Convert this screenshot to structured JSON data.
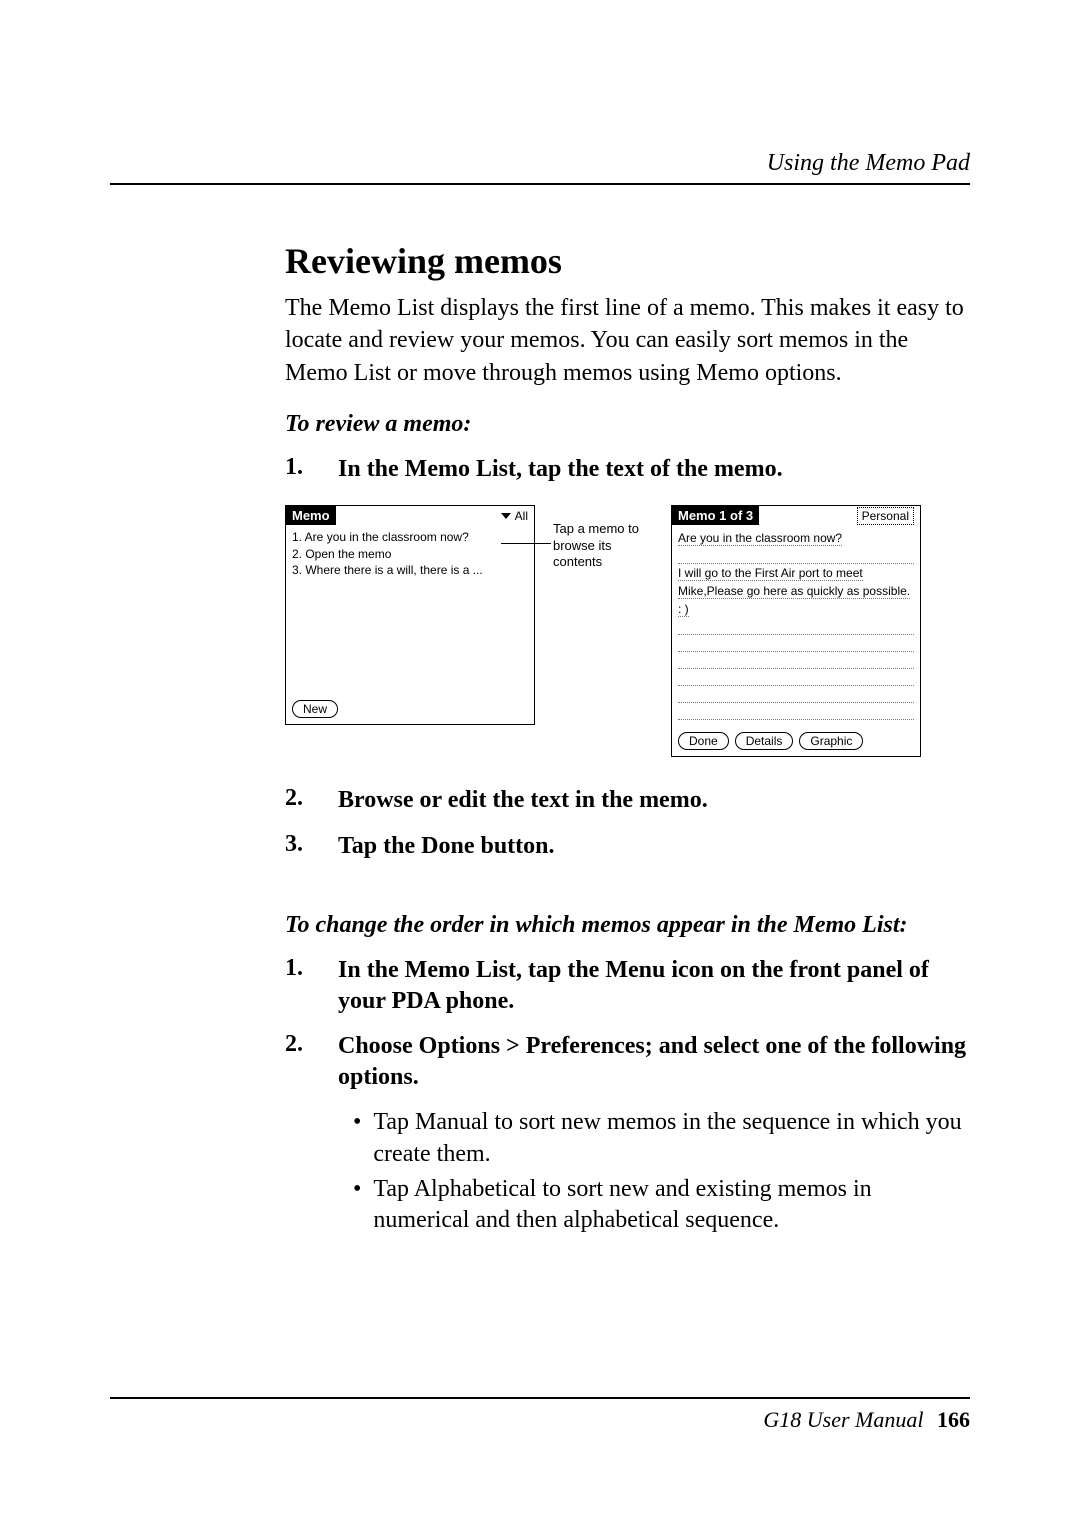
{
  "header": {
    "section": "Using the Memo Pad"
  },
  "h1": "Reviewing memos",
  "intro": "The Memo List displays the first line of a memo. This makes it easy to locate and review your memos. You can easily sort memos in the Memo List or move through memos using Memo options.",
  "review": {
    "subhead": "To review a memo:",
    "steps": [
      "In the Memo List, tap the text of the memo.",
      "Browse or edit the text in the memo.",
      "Tap the Done button."
    ]
  },
  "change_order": {
    "subhead": "To change the order in which memos appear in the Memo List:",
    "steps": [
      "In the Memo List, tap the Menu icon on the front panel of your PDA phone.",
      "Choose Options > Preferences; and select one of the following options."
    ],
    "bullets": [
      "Tap Manual to sort new memos in the sequence in which you create them.",
      "Tap Alphabetical to sort new and existing memos in numerical and then alphabetical sequence."
    ]
  },
  "fig": {
    "caption": "Tap a memo to browse its contents",
    "left": {
      "title": "Memo",
      "filter": "All",
      "items": [
        "1. Are  you in the classroom now?",
        "2. Open the memo",
        "3. Where there is a will, there is a ..."
      ],
      "new_btn": "New"
    },
    "right": {
      "title": "Memo 1 of 3",
      "category": "Personal",
      "line1": "Are  you in the classroom now?",
      "body": "I will go to the First Air port  to meet Mike,Please go here as quickly as possible. : )",
      "done_btn": "Done",
      "details_btn": "Details",
      "graphic_btn": "Graphic"
    }
  },
  "footer": {
    "manual": "G18 User Manual",
    "page": "166"
  }
}
